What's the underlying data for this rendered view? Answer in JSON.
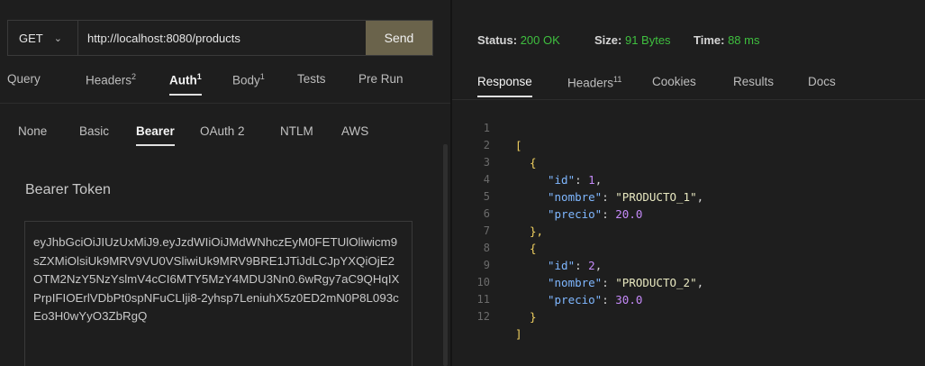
{
  "request": {
    "method": "GET",
    "url": "http://localhost:8080/products",
    "send_label": "Send",
    "tabs": [
      {
        "label": "Query",
        "count": ""
      },
      {
        "label": "Headers",
        "count": "2"
      },
      {
        "label": "Auth",
        "count": "1"
      },
      {
        "label": "Body",
        "count": "1"
      },
      {
        "label": "Tests",
        "count": ""
      },
      {
        "label": "Pre Run",
        "count": ""
      }
    ],
    "auth_tabs": [
      "None",
      "Basic",
      "Bearer",
      "OAuth 2",
      "NTLM",
      "AWS"
    ],
    "bearer_label": "Bearer Token",
    "token": "eyJhbGciOiJIUzUxMiJ9.eyJzdWIiOiJMdWNhczEyM0FETUlOliwicm9sZXMiOlsiUk9MRV9VU0VSliwiUk9MRV9BRE1JTiJdLCJpYXQiOjE2OTM2NzY5NzYslmV4cCI6MTY5MzY4MDU3Nn0.6wRgy7aC9QHqIXPrpIFIOErlVDbPt0spNFuCLIji8-2yhsp7LeniuhX5z0ED2mN0P8L093cEo3H0wYyO3ZbRgQ"
  },
  "response": {
    "status_label": "Status:",
    "status_value": "200 OK",
    "size_label": "Size:",
    "size_value": "91 Bytes",
    "time_label": "Time:",
    "time_value": "88 ms",
    "tabs": [
      {
        "label": "Response",
        "count": ""
      },
      {
        "label": "Headers",
        "count": "11"
      },
      {
        "label": "Cookies",
        "count": ""
      },
      {
        "label": "Results",
        "count": ""
      },
      {
        "label": "Docs",
        "count": ""
      }
    ],
    "line_numbers": [
      "1",
      "2",
      "3",
      "4",
      "5",
      "6",
      "7",
      "8",
      "9",
      "10",
      "11",
      "12"
    ],
    "products": [
      {
        "id": "1",
        "nombre": "\"PRODUCTO_1\"",
        "precio": "20.0"
      },
      {
        "id": "2",
        "nombre": "\"PRODUCTO_2\"",
        "precio": "30.0"
      }
    ],
    "keys": {
      "id": "\"id\"",
      "nombre": "\"nombre\"",
      "precio": "\"precio\""
    },
    "punct": {
      "open_arr": "[",
      "close_arr": "]",
      "open_obj": "{",
      "close_obj": "}",
      "close_obj_comma": "},"
    }
  },
  "colors": {
    "send_button": "#6a634b",
    "status_ok": "#3fbf3f",
    "json_key": "#7fb7ff",
    "json_number": "#c58af9",
    "background": "#1e1e1e"
  }
}
